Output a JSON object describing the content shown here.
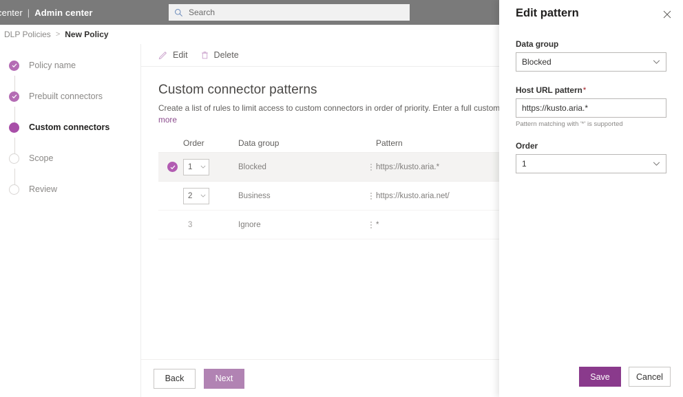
{
  "suitebar": {
    "brand_left": "in center",
    "separator": "|",
    "brand_right": "Admin center",
    "search_placeholder": "Search",
    "search_icon": "search-icon"
  },
  "breadcrumb": {
    "parent": "DLP Policies",
    "separator": ">",
    "current": "New Policy"
  },
  "wizard": {
    "steps": [
      {
        "label": "Policy name",
        "state": "done"
      },
      {
        "label": "Prebuilt connectors",
        "state": "done"
      },
      {
        "label": "Custom connectors",
        "state": "active"
      },
      {
        "label": "Scope",
        "state": "todo"
      },
      {
        "label": "Review",
        "state": "todo"
      }
    ]
  },
  "command_bar": {
    "edit_label": "Edit",
    "edit_icon": "pencil-icon",
    "delete_label": "Delete",
    "delete_icon": "trash-icon"
  },
  "page": {
    "title": "Custom connector patterns",
    "description": "Create a list of rules to limit access to custom connectors in order of priority. Enter a full custom connector U",
    "learn_more": "more"
  },
  "table": {
    "columns": [
      "Order",
      "Data group",
      "Pattern"
    ],
    "rows": [
      {
        "selected": true,
        "order": "1",
        "order_type": "dropdown",
        "data_group": "Blocked",
        "pattern": "https://kusto.aria.*"
      },
      {
        "selected": false,
        "order": "2",
        "order_type": "dropdown",
        "data_group": "Business",
        "pattern": "https://kusto.aria.net/"
      },
      {
        "selected": false,
        "order": "3",
        "order_type": "text",
        "data_group": "Ignore",
        "pattern": "*"
      }
    ]
  },
  "footer": {
    "back_label": "Back",
    "next_label": "Next"
  },
  "panel": {
    "title": "Edit pattern",
    "close_icon": "close-icon",
    "data_group": {
      "label": "Data group",
      "value": "Blocked",
      "chevron_icon": "chevron-down-icon"
    },
    "host_url": {
      "label": "Host URL pattern",
      "required_marker": "*",
      "value": "https://kusto.aria.*",
      "hint": "Pattern matching with '*' is supported"
    },
    "order": {
      "label": "Order",
      "value": "1",
      "chevron_icon": "chevron-down-icon"
    },
    "save_label": "Save",
    "cancel_label": "Cancel"
  },
  "colors": {
    "accent_purple": "#8a3a8c",
    "muted_purple": "#b183b3",
    "step_done": "#b46cb4",
    "step_active": "#a84fa8",
    "suitebar_bg": "#7a7a7a",
    "required_red": "#a4262c"
  }
}
